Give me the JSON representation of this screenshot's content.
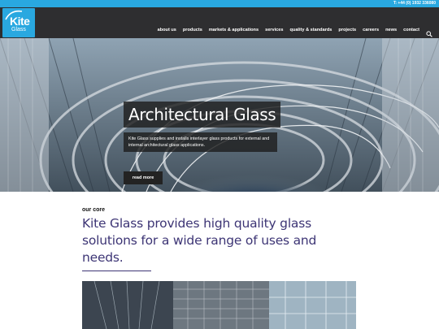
{
  "topbar": {
    "phone": "T: +44 (0) 1932 336080"
  },
  "logo": {
    "name_line1": "Kite",
    "name_line2": "Glass"
  },
  "nav": {
    "items": [
      "about us",
      "products",
      "markets & applications",
      "services",
      "quality & standards",
      "projects",
      "careers",
      "news",
      "contact"
    ],
    "search_icon": "search-icon"
  },
  "hero": {
    "title": "Architectural Glass",
    "description": "Kite Glass supplies and installs interlayer glass products for external and internal architectural glass applications.",
    "button_label": "read more",
    "prev_icon": "‹",
    "next_icon": "›"
  },
  "intro": {
    "eyebrow": "our core",
    "headline": "Kite Glass provides high quality glass solutions for a wide range of uses and needs."
  },
  "colors": {
    "accent": "#29a8e0",
    "header": "#1c1c1e",
    "headline": "#3d3575"
  }
}
